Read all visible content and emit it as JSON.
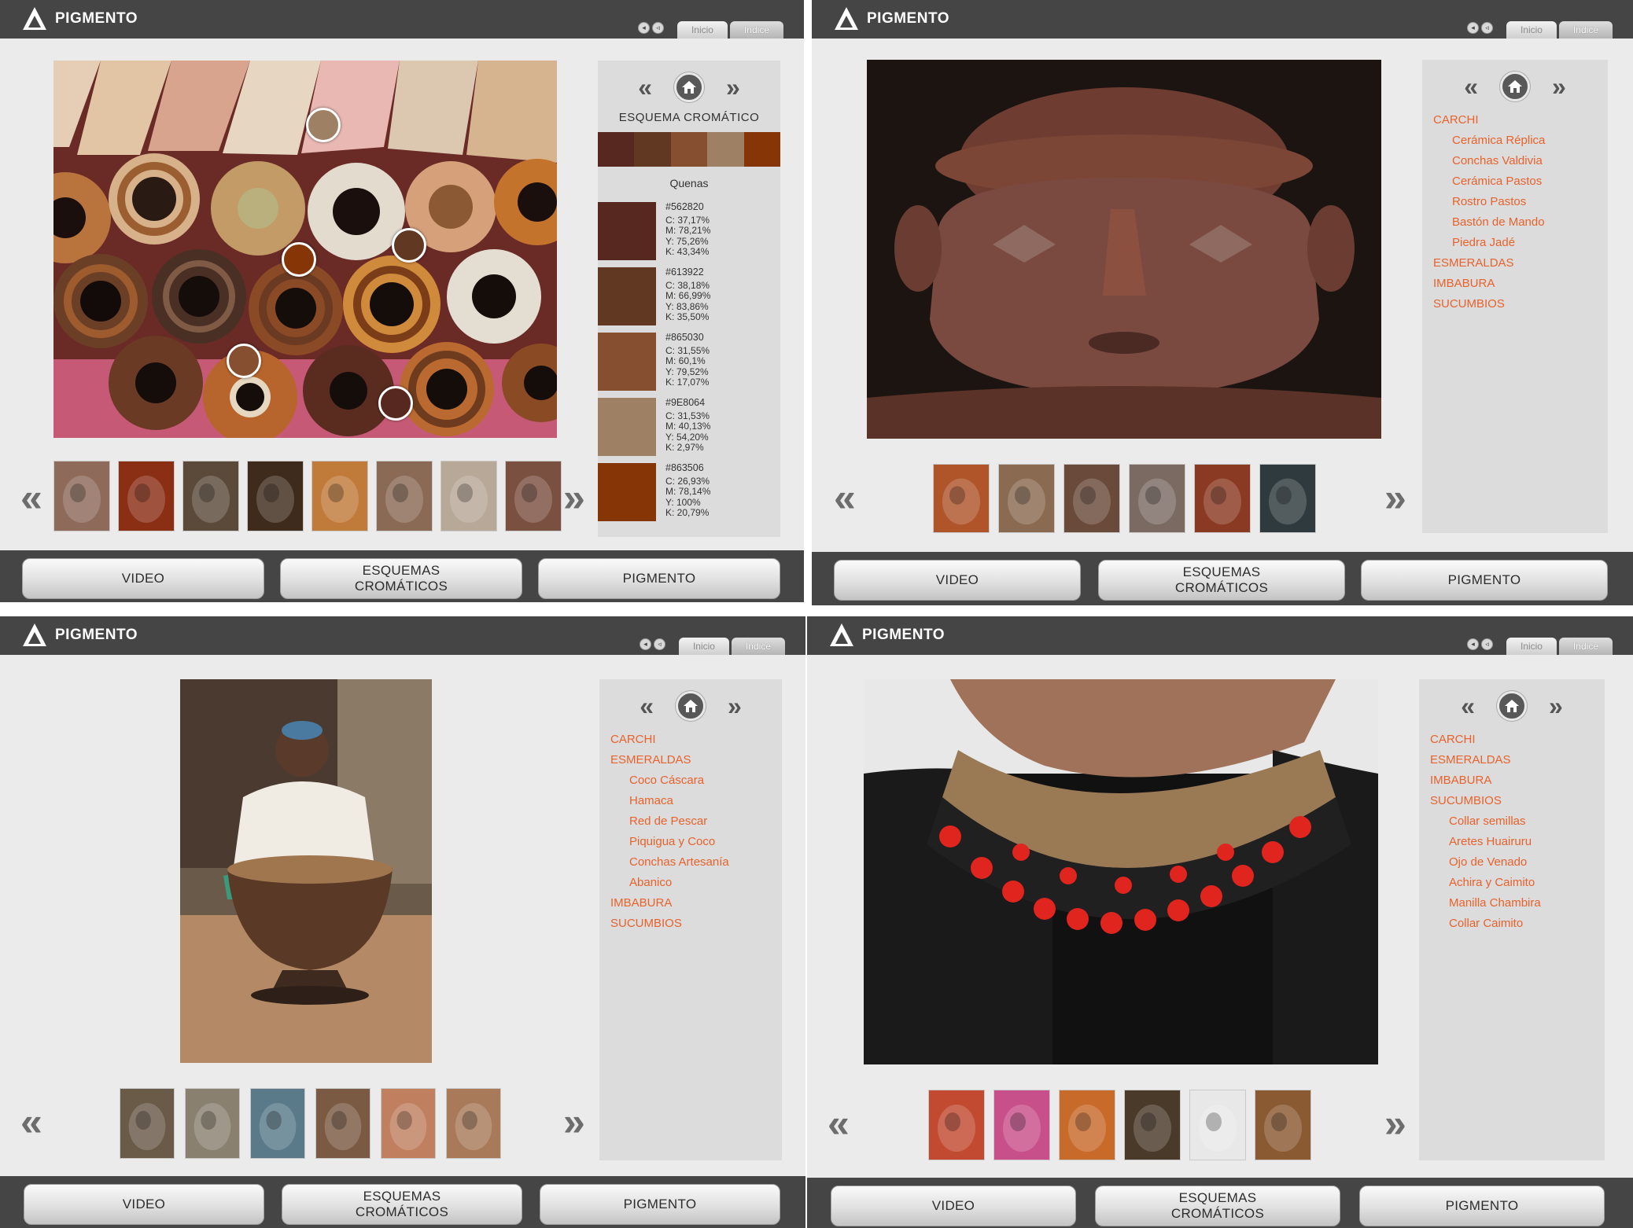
{
  "header": {
    "brand_name": "PIGMENTO",
    "tab_inicio": "Inicio",
    "tab_indice": "Índice"
  },
  "footer": {
    "video_label": "VIDEO",
    "esquemas_line1": "ESQUEMAS",
    "esquemas_line2": "CROMÁTICOS",
    "pigmento_label": "PIGMENTO"
  },
  "panel1": {
    "scheme_title": "ESQUEMA CROMÁTICO",
    "item_name": "Quenas",
    "strip_colors": [
      "#562820",
      "#613922",
      "#865030",
      "#9E8064",
      "#863506"
    ],
    "swatches": [
      {
        "hex": "#562820",
        "color": "#562820",
        "c": "C: 37,17%",
        "m": "M: 78,21%",
        "y": "Y: 75,26%",
        "k": "K: 43,34%"
      },
      {
        "hex": "#613922",
        "color": "#613922",
        "c": "C: 38,18%",
        "m": "M: 66,99%",
        "y": "Y: 83,86%",
        "k": "K: 35,50%"
      },
      {
        "hex": "#865030",
        "color": "#865030",
        "c": "C: 31,55%",
        "m": "M: 60,1%",
        "y": "Y: 79,52%",
        "k": "K: 17,07%"
      },
      {
        "hex": "#9E8064",
        "color": "#9E8064",
        "c": "C: 31,53%",
        "m": "M: 40,13%",
        "y": "Y: 54,20%",
        "k": "K: 2,97%"
      },
      {
        "hex": "#863506",
        "color": "#863506",
        "c": "C: 26,93%",
        "m": "M: 78,14%",
        "y": "Y: 100%",
        "k": "K: 20,79%"
      }
    ]
  },
  "panel2": {
    "menu": [
      {
        "label": "CARCHI",
        "sub": false
      },
      {
        "label": "Cerámica Réplica",
        "sub": true
      },
      {
        "label": "Conchas Valdivia",
        "sub": true
      },
      {
        "label": "Cerámica Pastos",
        "sub": true
      },
      {
        "label": "Rostro Pastos",
        "sub": true
      },
      {
        "label": "Bastón de Mando",
        "sub": true
      },
      {
        "label": "Piedra Jadé",
        "sub": true
      },
      {
        "label": "ESMERALDAS",
        "sub": false
      },
      {
        "label": "IMBABURA",
        "sub": false
      },
      {
        "label": "SUCUMBIOS",
        "sub": false
      }
    ]
  },
  "panel3": {
    "menu": [
      {
        "label": "CARCHI",
        "sub": false
      },
      {
        "label": "ESMERALDAS",
        "sub": false
      },
      {
        "label": "Coco Cáscara",
        "sub": true
      },
      {
        "label": "Hamaca",
        "sub": true
      },
      {
        "label": "Red de Pescar",
        "sub": true
      },
      {
        "label": "Piquigua y Coco",
        "sub": true
      },
      {
        "label": "Conchas Artesanía",
        "sub": true
      },
      {
        "label": "Abanico",
        "sub": true
      },
      {
        "label": "IMBABURA",
        "sub": false
      },
      {
        "label": "SUCUMBIOS",
        "sub": false
      }
    ]
  },
  "panel4": {
    "menu": [
      {
        "label": "CARCHI",
        "sub": false
      },
      {
        "label": "ESMERALDAS",
        "sub": false
      },
      {
        "label": "IMBABURA",
        "sub": false
      },
      {
        "label": "SUCUMBIOS",
        "sub": false
      },
      {
        "label": "Collar semillas",
        "sub": true
      },
      {
        "label": "Aretes Huairuru",
        "sub": true
      },
      {
        "label": "Ojo de Venado",
        "sub": true
      },
      {
        "label": "Achira y Caimito",
        "sub": true
      },
      {
        "label": "Manilla Chambira",
        "sub": true
      },
      {
        "label": "Collar Caimito",
        "sub": true
      }
    ]
  },
  "thumbnails": {
    "panel1": [
      "#8d6a5a",
      "#8a2e14",
      "#5b4a3a",
      "#3e2b1c",
      "#c07a3a",
      "#8a6a55",
      "#b8a898",
      "#7a5040"
    ],
    "panel2": [
      "#b0552a",
      "#8a6a50",
      "#6a4a3a",
      "#7a6a62",
      "#8a3a22",
      "#2e3a3e"
    ],
    "panel3": [
      "#6a5a48",
      "#8a8070",
      "#5a7a8a",
      "#7a5a42",
      "#c08060",
      "#a87a5a"
    ],
    "panel4": [
      "#c24a30",
      "#c8508a",
      "#c86a2a",
      "#4a3a2a",
      "#e8e8e8",
      "#8a5a32"
    ]
  },
  "icons": {
    "logo": "pigmento-logo-icon",
    "home": "home-icon",
    "prev": "double-chevron-left-icon",
    "next": "double-chevron-right-icon",
    "sound": "speaker-icon"
  },
  "colors": {
    "accent": "#e8622c",
    "topbar": "#454545",
    "panel_bg": "#ebebeb",
    "sidebar_bg": "#dcdcdc"
  }
}
